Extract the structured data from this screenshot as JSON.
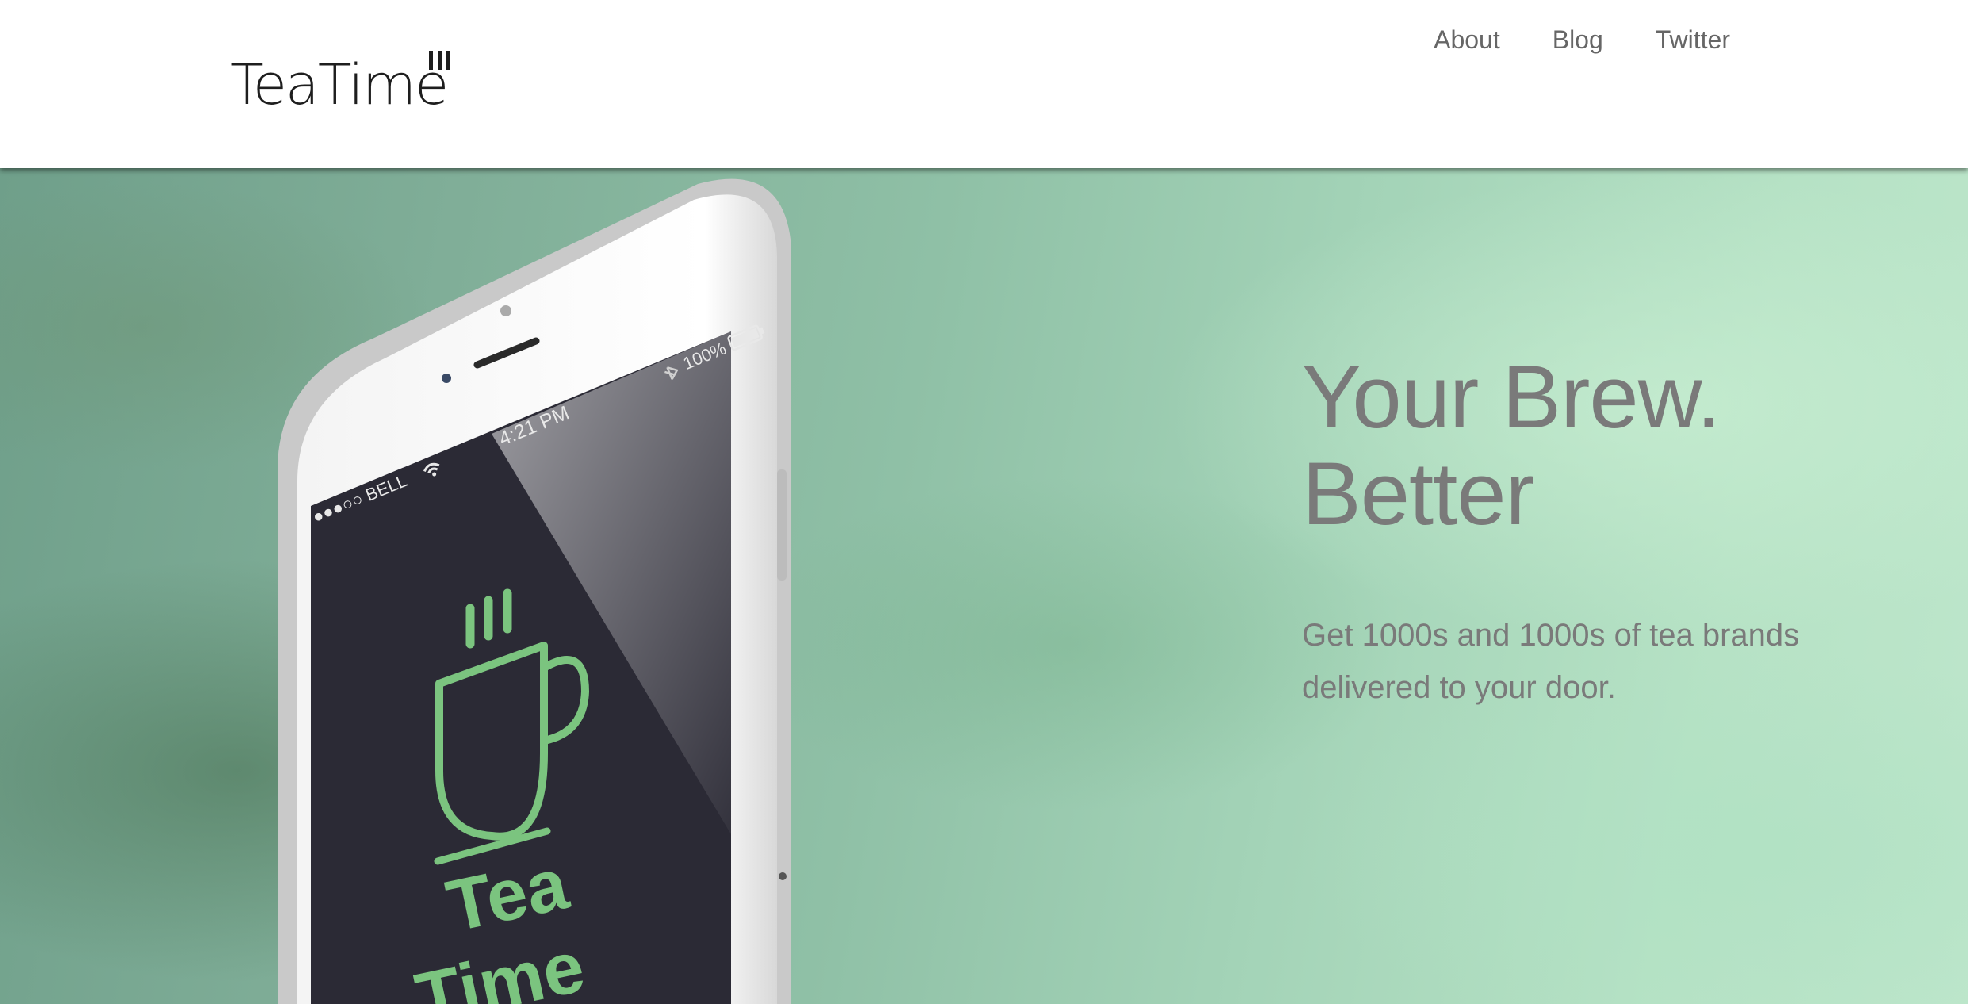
{
  "header": {
    "logo_text": "TeaTime",
    "nav": [
      {
        "label": "About"
      },
      {
        "label": "Blog"
      },
      {
        "label": "Twitter"
      }
    ]
  },
  "hero": {
    "title_line1": "Your Brew.",
    "title_line2": "Better",
    "subtitle": "Get 1000s and 1000s of tea brands delivered to your door."
  },
  "phone_screen": {
    "carrier": "●●●○○ BELL",
    "time": "4:21 PM",
    "battery": "100%",
    "app_name_line1": "Tea",
    "app_name_line2": "Time"
  },
  "colors": {
    "accent_green": "#7bc47f",
    "screen_dark": "#2b2a35",
    "text_gray": "#7a7a7a"
  },
  "icons": [
    "teacup-steam-icon",
    "wifi-icon",
    "bluetooth-icon",
    "battery-icon"
  ]
}
